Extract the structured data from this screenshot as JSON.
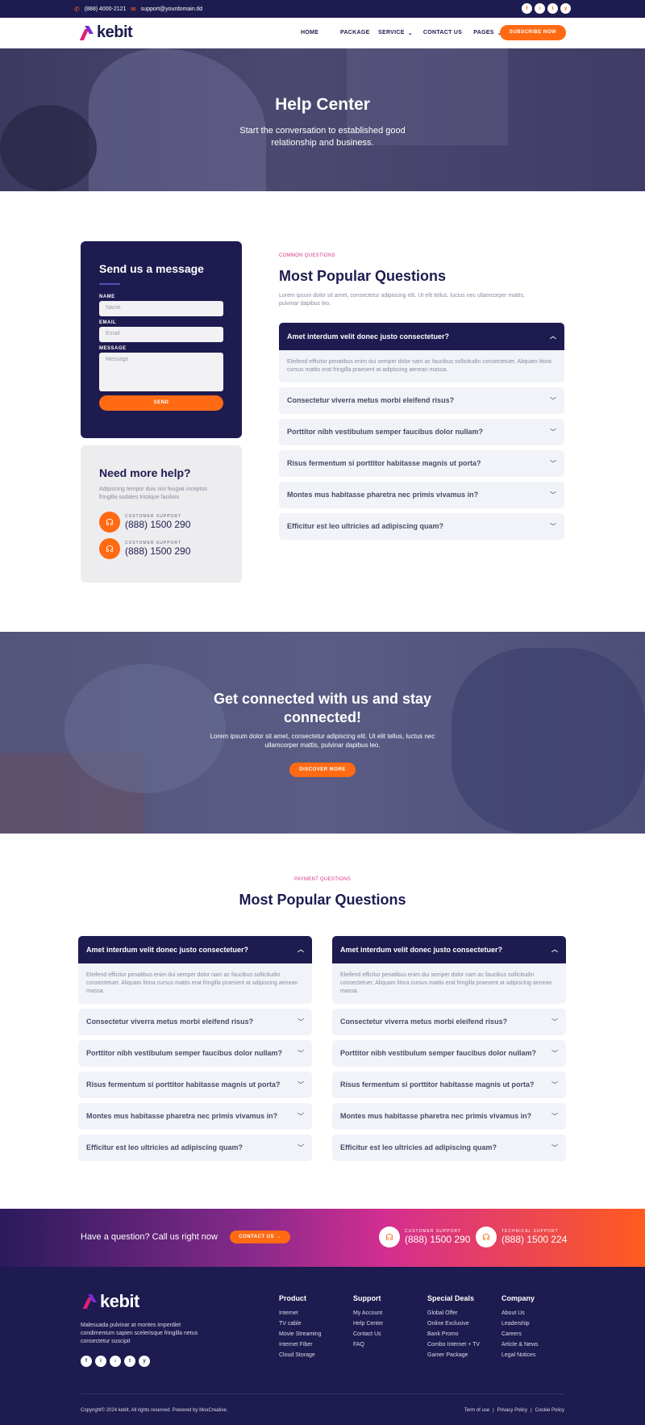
{
  "topbar": {
    "phone": "(888) 4000-2121",
    "email": "support@yourdomain.tld",
    "social": [
      "f",
      "i",
      "t",
      "y"
    ]
  },
  "brand": {
    "name": "kebit"
  },
  "nav": {
    "items": [
      "HOME",
      "PACKAGE",
      "SERVICE",
      "CONTACT US",
      "PAGES"
    ],
    "subscribe": "SUBSCRIBE NOW"
  },
  "hero": {
    "title": "Help Center",
    "subtitle": "Start the conversation to established good relationship and business."
  },
  "contact_form": {
    "title": "Send us a message",
    "name_label": "NAME",
    "name_placeholder": "Name",
    "email_label": "EMAIL",
    "email_placeholder": "Email",
    "message_label": "MESSAGE",
    "message_placeholder": "Message",
    "send": "SEND"
  },
  "help": {
    "title": "Need more help?",
    "text": "Adipiscing tempor duis nisi feugiat inceptos fringilla sodales tristique facilisis",
    "support": [
      {
        "label": "CUSTOMER SUPPORT",
        "number": "(888) 1500 290"
      },
      {
        "label": "CUSTOMER SUPPORT",
        "number": "(888) 1500 290"
      }
    ]
  },
  "common": {
    "tag": "COMMON QUESTIONS",
    "title": "Most Popular Questions",
    "lead": "Lorem ipsum dolor sit amet, consectetur adipiscing elit. Ut elit tellus, luctus nec ullamcorper mattis, pulvinar dapibus leo.",
    "open_q": "Amet interdum velit donec justo consectetuer?",
    "open_a": "Eleifend efficitur penatibus enim dui semper dolor nam ac faucibus sollicitudin consectetuer. Aliquam litora cursus mattis erat fringilla praesent at adipiscing aenean massa.",
    "questions": [
      "Consectetur viverra metus morbi eleifend risus?",
      "Porttitor nibh vestibulum semper faucibus dolor nullam?",
      "Risus fermentum si porttitor habitasse magnis ut porta?",
      "Montes mus habitasse pharetra nec primis vivamus in?",
      "Efficitur est leo ultricies ad adipiscing quam?"
    ]
  },
  "cta": {
    "title": "Get connected with us and stay connected!",
    "text": "Lorem ipsum dolor sit amet, consectetur adipiscing elit. Ut elit tellus, luctus nec ullamcorper mattis, pulvinar dapibus leo.",
    "button": "DISCOVER MORE"
  },
  "payment": {
    "tag": "PAYMENT QUESTIONS",
    "title": "Most Popular Questions",
    "open_q": "Amet interdum velit donec justo consectetuer?",
    "open_a": "Eleifend efficitur penatibus enim dui semper dolor nam ac faucibus sollicitudin consectetuer. Aliquam litora cursus mattis erat fringilla praesent at adipiscing aenean massa.",
    "questions": [
      "Consectetur viverra metus morbi eleifend risus?",
      "Porttitor nibh vestibulum semper faucibus dolor nullam?",
      "Risus fermentum si porttitor habitasse magnis ut porta?",
      "Montes mus habitasse pharetra nec primis vivamus in?",
      "Efficitur est leo ultricies ad adipiscing quam?"
    ]
  },
  "band": {
    "question": "Have a question? Call us right now",
    "button": "CONTACT US →",
    "customer_label": "CUSTOMER SUPPORT",
    "customer_number": "(888) 1500 290",
    "tech_label": "TECHNICAL SUPPORT",
    "tech_number": "(888) 1500 224"
  },
  "footer": {
    "desc": "Malesuada pulvinar at montes imperdiet condimentum sapien scelerisque fringilla netus consectetur suscipit",
    "cols": [
      {
        "title": "Product",
        "links": [
          "Internet",
          "TV cable",
          "Movie Streaming",
          "Internet Fiber",
          "Cloud Storage"
        ]
      },
      {
        "title": "Support",
        "links": [
          "My Account",
          "Help Center",
          "Contact Us",
          "FAQ"
        ]
      },
      {
        "title": "Special Deals",
        "links": [
          "Global Offer",
          "Online Exclusive",
          "Bank Promo",
          "Combo Internet + TV",
          "Gamer Package"
        ]
      },
      {
        "title": "Company",
        "links": [
          "About Us",
          "Leadership",
          "Careers",
          "Article & News",
          "Legal Notices"
        ]
      }
    ],
    "copyright": "Copyright© 2024 kebit, All rights reserved. Powered by MoxCreative.",
    "legal": [
      "Term of use",
      "Privacy Policy",
      "Cookie Policy"
    ]
  },
  "colors": {
    "navy": "#1d1b4f",
    "orange": "#ff6a13",
    "pink": "#d63384"
  }
}
